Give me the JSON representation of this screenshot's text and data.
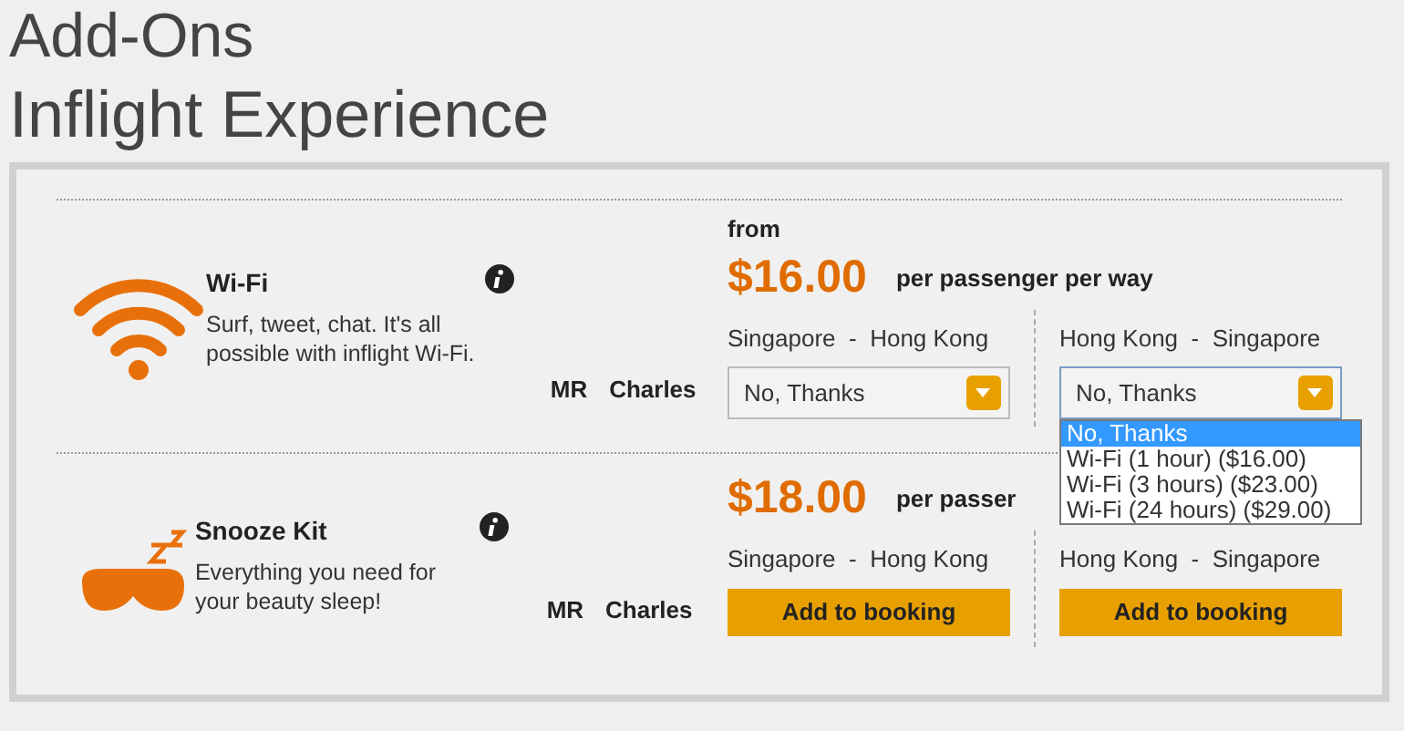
{
  "page_title": "Add-Ons",
  "section_title": "Inflight Experience",
  "addons": [
    {
      "kind": "wifi",
      "name": "Wi-Fi",
      "description": "Surf, tweet, chat. It's all possible with inflight Wi-Fi.",
      "title": "MR",
      "passenger": "Charles",
      "from_label": "from",
      "price": "$16.00",
      "price_note": "per passenger per way",
      "legs": [
        {
          "kind": "select",
          "route_from": "Singapore",
          "separator": "-",
          "route_to": "Hong Kong",
          "value": "No, Thanks",
          "expanded": false
        },
        {
          "kind": "select",
          "route_from": "Hong Kong",
          "separator": "-",
          "route_to": "Singapore",
          "value": "No, Thanks",
          "expanded": true,
          "options": [
            {
              "label": "No, Thanks",
              "selected": true
            },
            {
              "label": "Wi-Fi (1 hour) ($16.00)",
              "selected": false
            },
            {
              "label": "Wi-Fi (3 hours) ($23.00)",
              "selected": false
            },
            {
              "label": "Wi-Fi (24 hours) ($29.00)",
              "selected": false
            }
          ]
        }
      ]
    },
    {
      "kind": "snooze",
      "name": "Snooze Kit",
      "description": "Everything you need for your beauty sleep!",
      "title": "MR",
      "passenger": "Charles",
      "price": "$18.00",
      "price_note": "per passer",
      "legs": [
        {
          "kind": "button",
          "route_from": "Singapore",
          "separator": "-",
          "route_to": "Hong Kong",
          "button": "Add to booking"
        },
        {
          "kind": "button",
          "route_from": "Hong Kong",
          "separator": "-",
          "route_to": "Singapore",
          "button": "Add to booking"
        }
      ]
    }
  ]
}
